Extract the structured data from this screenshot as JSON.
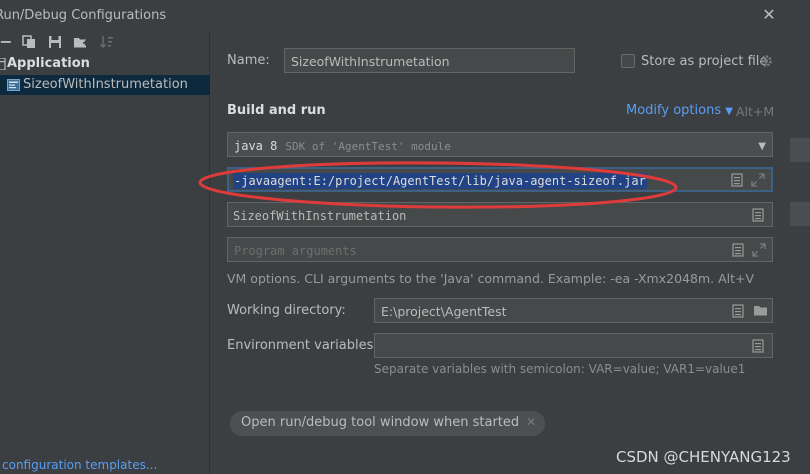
{
  "window": {
    "title": "Run/Debug Configurations",
    "close_glyph": "✕"
  },
  "toolbar": {
    "icons": [
      "minus-icon",
      "copy-icon",
      "save-icon",
      "add-folder-icon",
      "sort-icon"
    ],
    "minus_glyph": "−"
  },
  "tree": {
    "group_label": "Application",
    "item_label": "SizeofWithInstrumetation"
  },
  "footer": {
    "link_label": "configuration templates..."
  },
  "form": {
    "name_label": "Name:",
    "name_value": "SizeofWithInstrumetation",
    "store_label": "Store as project file",
    "store_checked": false,
    "section_title": "Build and run",
    "modify_options": "Modify options",
    "modify_shortcut": "Alt+M",
    "sdk_value": "java 8",
    "sdk_detail": "SDK of 'AgentTest' module",
    "vm_options_value": "-javaagent:E:/project/AgentTest/lib/java-agent-sizeof.jar",
    "main_class_value": "SizeofWithInstrumetation",
    "program_args_placeholder": "Program arguments",
    "vm_hint": "VM options. CLI arguments to the 'Java' command. Example: -ea -Xmx2048m. Alt+V",
    "workdir_label": "Working directory:",
    "workdir_value": "E:\\project\\AgentTest",
    "env_label": "Environment variables:",
    "env_value": "",
    "env_hint": "Separate variables with semicolon: VAR=value; VAR1=value1",
    "chip_label": "Open run/debug tool window when started"
  },
  "watermark": "CSDN @CHENYANG123",
  "colors": {
    "background": "#3c3f41",
    "field": "#45494a",
    "selection": "#214283",
    "link": "#589df6",
    "annotation": "#e03b3b"
  }
}
